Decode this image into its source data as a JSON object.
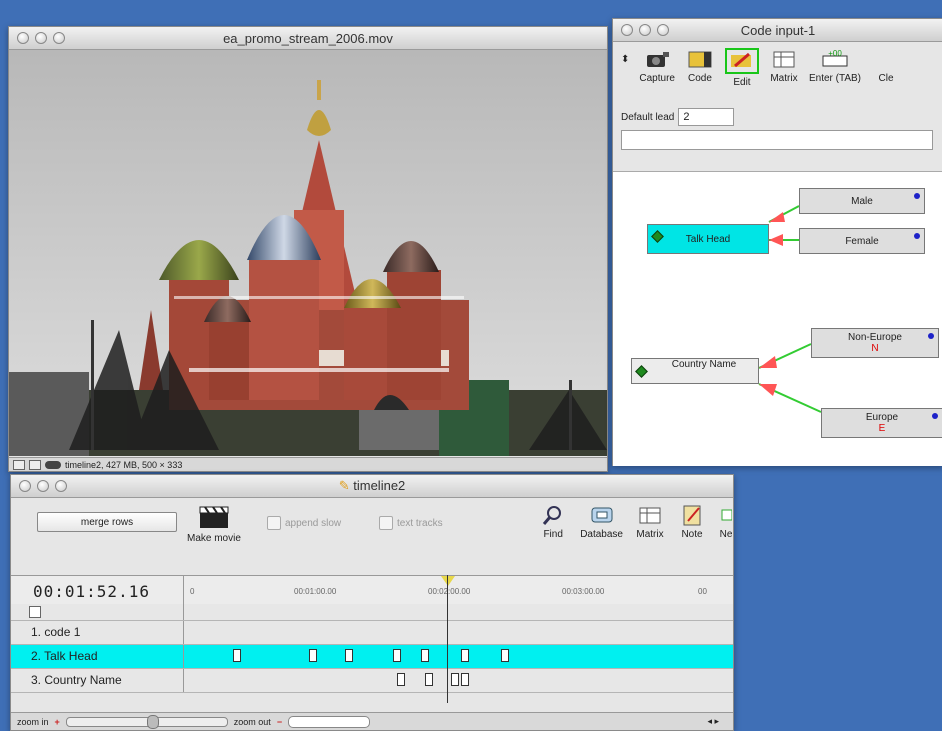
{
  "movie_window": {
    "title": "ea_promo_stream_2006.mov",
    "status": "timeline2, 427 MB,  500 × 333"
  },
  "code_window": {
    "title": "Code input-1",
    "toolbar": [
      {
        "label": "Capture",
        "icon": "camera-icon"
      },
      {
        "label": "Code",
        "icon": "code-icon"
      },
      {
        "label": "Edit",
        "icon": "edit-icon"
      },
      {
        "label": "Matrix",
        "icon": "matrix-icon"
      },
      {
        "label": "Enter (TAB)",
        "icon": "enter-icon"
      },
      {
        "label": "Cle",
        "icon": "clear-icon"
      }
    ],
    "default_lead_label": "Default lead",
    "default_lead_value": "2",
    "nodes": {
      "talk_head": "Talk Head",
      "male": "Male",
      "female": "Female",
      "country_name": "Country Name",
      "non_europe": "Non-Europe",
      "non_europe_key": "N",
      "europe": "Europe",
      "europe_key": "E"
    }
  },
  "timeline_window": {
    "title": "timeline2",
    "merge_rows": "merge rows",
    "make_movie": "Make movie",
    "append_slow": "append slow",
    "text_tracks": "text tracks",
    "tools": [
      {
        "label": "Find",
        "icon": "find-icon"
      },
      {
        "label": "Database",
        "icon": "database-icon"
      },
      {
        "label": "Matrix",
        "icon": "matrix-icon"
      },
      {
        "label": "Note",
        "icon": "note-icon"
      },
      {
        "label": "Ne",
        "icon": "new-icon"
      }
    ],
    "timecode": "00:01:52.16",
    "ruler_ticks": [
      "0",
      "00:01:00.00",
      "00:02:00.00",
      "00:03:00.00",
      "00"
    ],
    "tracks": [
      {
        "label": "1. code  1"
      },
      {
        "label": "2. Talk Head"
      },
      {
        "label": "3. Country Name"
      }
    ],
    "zoom_in": "zoom in",
    "zoom_out": "zoom out"
  }
}
